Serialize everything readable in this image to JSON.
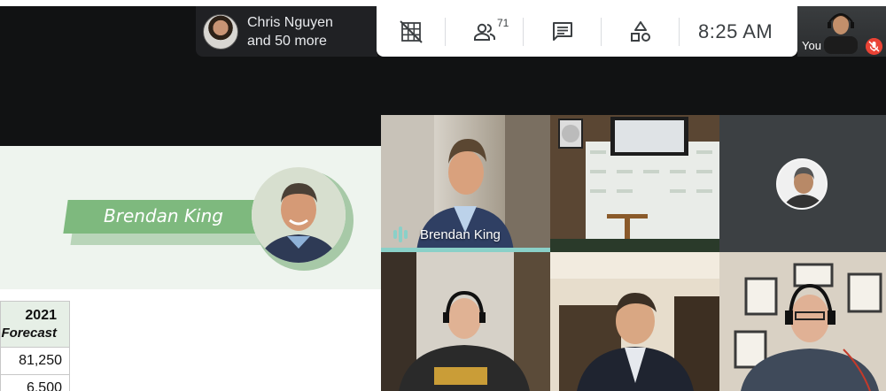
{
  "presenter": {
    "line1": "Chris Nguyen",
    "line2": "and 50 more"
  },
  "toolbar": {
    "grid_icon": "grid-off-icon",
    "people_icon": "people-icon",
    "people_count": "71",
    "chat_icon": "chat-icon",
    "activities_icon": "shapes-icon",
    "time": "8:25  AM"
  },
  "self_view": {
    "label": "You",
    "mic_state": "muted"
  },
  "slide": {
    "speaker_name": "Brendan King",
    "table": {
      "header_year": "2021",
      "header_sub": "Forecast",
      "values": [
        "81,250",
        "6,500"
      ]
    }
  },
  "tiles": {
    "active_speaker": "Brendan King"
  },
  "colors": {
    "accent": "#8ad0c8",
    "ribbon": "#7eb97e",
    "mic_off": "#ea4335"
  }
}
